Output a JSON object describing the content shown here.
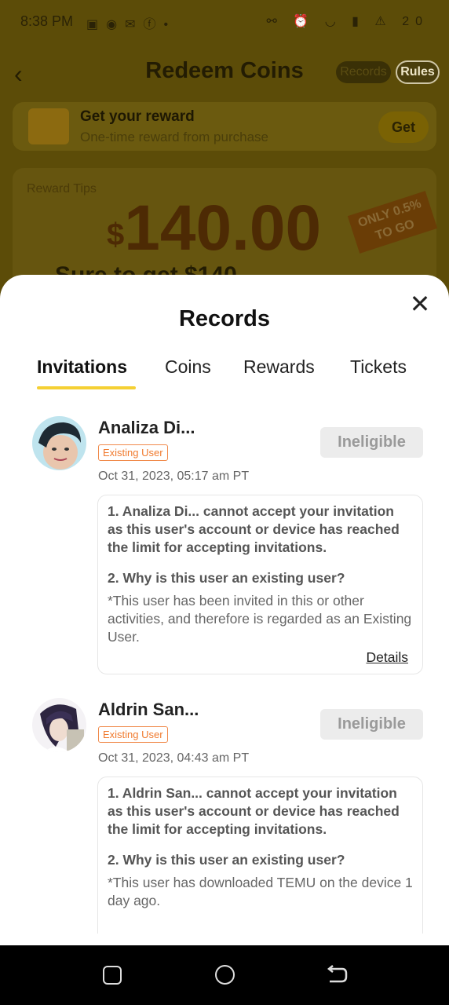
{
  "status_bar": {
    "time": "8:38 PM",
    "battery": "20"
  },
  "background": {
    "title": "Redeem Coins",
    "records_btn": "Records",
    "rules_btn": "Rules",
    "reward_title": "Get your reward",
    "reward_subtitle": "One-time reward from purchase",
    "get_btn": "Get",
    "reward_tips": "Reward Tips",
    "amount_currency": "$",
    "amount": "140.00",
    "only_badge": "ONLY 0.5% TO GO",
    "sure_text": "Sure to get $140"
  },
  "sheet": {
    "title": "Records",
    "tabs": [
      "Invitations",
      "Coins",
      "Rewards",
      "Tickets"
    ],
    "active_tab": "Invitations"
  },
  "entries": [
    {
      "name": "Analiza Di...",
      "badge": "Existing User",
      "status": "Ineligible",
      "date": "Oct 31, 2023, 05:17 am PT",
      "reason": "1. Analiza Di... cannot accept your invitation as this user's account or device has reached the limit for accepting invitations.",
      "question": "2. Why is this user an existing user?",
      "answer": "*This user has been invited in this or other activities, and therefore is regarded as an Existing User.",
      "details": "Details"
    },
    {
      "name": "Aldrin San...",
      "badge": "Existing User",
      "status": "Ineligible",
      "date": "Oct 31, 2023, 04:43 am PT",
      "reason": "1. Aldrin San... cannot accept your invitation as this user's account or device has reached the limit for accepting invitations.",
      "question": "2. Why is this user an existing user?",
      "answer": "*This user has downloaded TEMU on the device 1 day ago."
    }
  ],
  "colors": {
    "accent": "#f5d033",
    "badge": "#f07a2e",
    "ineligible_bg": "#ececec"
  }
}
